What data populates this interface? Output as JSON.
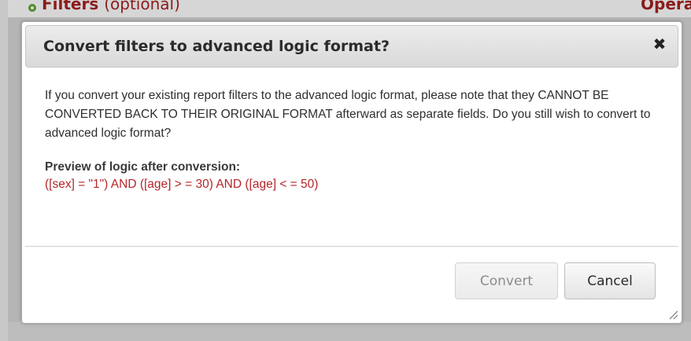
{
  "background": {
    "section_title": "Filters",
    "section_optional": "(optional)",
    "column_header": "Operat"
  },
  "dialog": {
    "title": "Convert filters to advanced logic format?",
    "close_glyph": "✖",
    "message": "If you convert your existing report filters to the advanced logic format, please note that they CANNOT BE CONVERTED BACK TO THEIR ORIGINAL FORMAT afterward as separate fields. Do you still wish to convert to advanced logic format?",
    "preview_label": "Preview of logic after conversion:",
    "preview_logic": "([sex] = \"1\") AND ([age] > = 30) AND ([age] < = 50)",
    "buttons": {
      "convert": "Convert",
      "cancel": "Cancel"
    }
  },
  "colors": {
    "logic_text": "#b3262a",
    "section_title": "#8b1c1c"
  }
}
